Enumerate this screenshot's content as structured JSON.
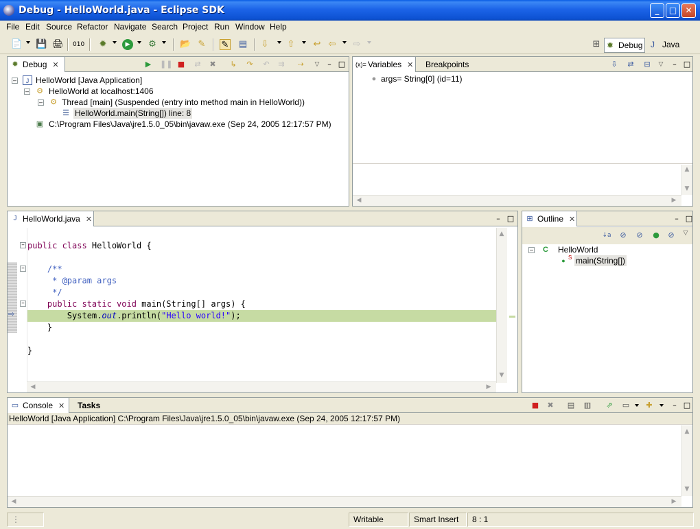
{
  "window": {
    "title": "Debug - HelloWorld.java - Eclipse SDK"
  },
  "menu": [
    "File",
    "Edit",
    "Source",
    "Refactor",
    "Navigate",
    "Search",
    "Project",
    "Run",
    "Window",
    "Help"
  ],
  "perspectives": [
    {
      "label": "Debug",
      "active": true
    },
    {
      "label": "Java",
      "active": false
    }
  ],
  "debug_view": {
    "tab": "Debug",
    "tree": [
      {
        "label": "HelloWorld [Java Application]",
        "icon": "java-app-icon"
      },
      {
        "label": "HelloWorld at localhost:1406",
        "icon": "debug-target-icon"
      },
      {
        "label": "Thread [main] (Suspended (entry into method main in HelloWorld))",
        "icon": "thread-icon"
      },
      {
        "label": "HelloWorld.main(String[]) line: 8",
        "icon": "stack-frame-icon"
      },
      {
        "label": "C:\\Program Files\\Java\\jre1.5.0_05\\bin\\javaw.exe (Sep 24, 2005 12:17:57 PM)",
        "icon": "process-icon"
      }
    ]
  },
  "variables_view": {
    "tabs": [
      "Variables",
      "Breakpoints"
    ],
    "rows": [
      {
        "label": "args= String[0]  (id=11)"
      }
    ]
  },
  "editor": {
    "tab": "HelloWorld.java",
    "lines": [
      {
        "parts": [
          {
            "t": "public class",
            "c": "kw"
          },
          {
            "t": " HelloWorld {",
            "c": ""
          }
        ]
      },
      {
        "parts": []
      },
      {
        "parts": [
          {
            "t": "    /**",
            "c": "cm"
          }
        ]
      },
      {
        "parts": [
          {
            "t": "     * @param args",
            "c": "cm"
          }
        ]
      },
      {
        "parts": [
          {
            "t": "     */",
            "c": "cm"
          }
        ]
      },
      {
        "parts": [
          {
            "t": "    public static void",
            "c": "kw"
          },
          {
            "t": " main(String[] args) {",
            "c": ""
          }
        ]
      },
      {
        "parts": [
          {
            "t": "        System.",
            "c": ""
          },
          {
            "t": "out",
            "c": "fld"
          },
          {
            "t": ".println(",
            "c": ""
          },
          {
            "t": "\"Hello world!\"",
            "c": "str"
          },
          {
            "t": ");",
            "c": ""
          }
        ],
        "current": true
      },
      {
        "parts": [
          {
            "t": "    }",
            "c": ""
          }
        ]
      },
      {
        "parts": []
      },
      {
        "parts": [
          {
            "t": "}",
            "c": ""
          }
        ]
      }
    ]
  },
  "outline_view": {
    "tab": "Outline",
    "tree": [
      {
        "label": "HelloWorld",
        "icon": "class-icon"
      },
      {
        "label": "main(String[])",
        "icon": "method-icon",
        "modifier": "S"
      }
    ]
  },
  "console_view": {
    "tabs": [
      "Console",
      "Tasks"
    ],
    "header": "HelloWorld [Java Application] C:\\Program Files\\Java\\jre1.5.0_05\\bin\\javaw.exe (Sep 24, 2005 12:17:57 PM)"
  },
  "status": {
    "writable": "Writable",
    "insert_mode": "Smart Insert",
    "position": "8 : 1"
  },
  "colors": {
    "current_line": "#c6dba3",
    "title_bar": "#0a5de4",
    "keyword": "#7f0055",
    "comment": "#3f5fbf",
    "string": "#2a00ff"
  }
}
